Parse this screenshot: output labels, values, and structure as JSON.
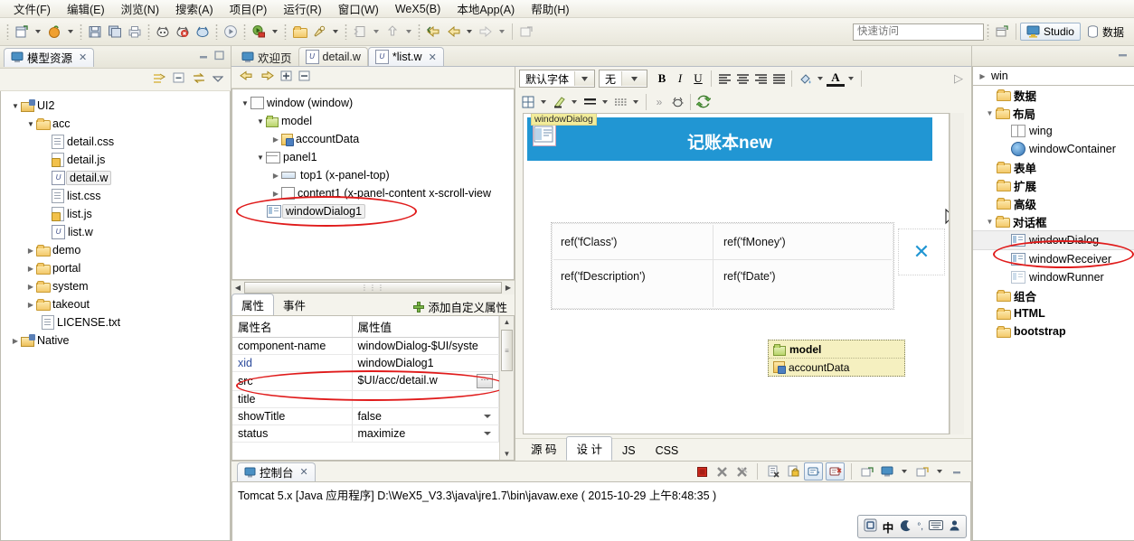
{
  "menubar": [
    {
      "label": "文件(F)",
      "mnemonic": "F"
    },
    {
      "label": "编辑(E)",
      "mnemonic": "E"
    },
    {
      "label": "浏览(N)",
      "mnemonic": "N"
    },
    {
      "label": "搜索(A)",
      "mnemonic": "A"
    },
    {
      "label": "项目(P)",
      "mnemonic": "P"
    },
    {
      "label": "运行(R)",
      "mnemonic": "R"
    },
    {
      "label": "窗口(W)",
      "mnemonic": "W"
    },
    {
      "label": "WeX5(B)",
      "mnemonic": "B"
    },
    {
      "label": "本地App(A)",
      "mnemonic": "A"
    },
    {
      "label": "帮助(H)",
      "mnemonic": "H"
    }
  ],
  "toolbar": {
    "quick_access_placeholder": "快速访问",
    "perspective_studio": "Studio",
    "perspective_data": "数据",
    "icons": [
      "new-file-icon",
      "open-resource-icon",
      "save-icon",
      "save-all-icon",
      "print-icon",
      "build-icon",
      "build-error-icon",
      "build-debug-icon",
      "run-icon",
      "debug-icon",
      "open-type-icon",
      "search-icon",
      "annotation-icon",
      "next-annotation-icon",
      "back-icon",
      "forward-icon",
      "last-edit-icon",
      "new-window-icon"
    ]
  },
  "left_panel": {
    "tab_title": "模型资源",
    "tree": [
      {
        "label": "UI2",
        "depth": 0,
        "icon": "project-icon",
        "state": "open"
      },
      {
        "label": "acc",
        "depth": 1,
        "icon": "folder-icon",
        "state": "open"
      },
      {
        "label": "detail.css",
        "depth": 2,
        "icon": "css-file-icon",
        "state": "leaf"
      },
      {
        "label": "detail.js",
        "depth": 2,
        "icon": "js-file-icon",
        "state": "leaf"
      },
      {
        "label": "detail.w",
        "depth": 2,
        "icon": "w-file-icon",
        "state": "selected"
      },
      {
        "label": "list.css",
        "depth": 2,
        "icon": "css-file-icon",
        "state": "leaf"
      },
      {
        "label": "list.js",
        "depth": 2,
        "icon": "js-file-icon",
        "state": "leaf"
      },
      {
        "label": "list.w",
        "depth": 2,
        "icon": "w-file-icon",
        "state": "leaf"
      },
      {
        "label": "demo",
        "depth": 1,
        "icon": "folder-icon",
        "state": "closed"
      },
      {
        "label": "portal",
        "depth": 1,
        "icon": "folder-icon",
        "state": "closed"
      },
      {
        "label": "system",
        "depth": 1,
        "icon": "folder-icon",
        "state": "closed"
      },
      {
        "label": "takeout",
        "depth": 1,
        "icon": "folder-icon",
        "state": "closed"
      },
      {
        "label": "LICENSE.txt",
        "depth": 2,
        "icon": "text-file-icon",
        "state": "leaf"
      },
      {
        "label": "Native",
        "depth": 0,
        "icon": "project-icon",
        "state": "closed"
      }
    ]
  },
  "editor_tabs": [
    {
      "label": "欢迎页",
      "active": false,
      "dirty": false,
      "icon": "welcome-icon"
    },
    {
      "label": "detail.w",
      "active": false,
      "dirty": false,
      "icon": "w-file-icon"
    },
    {
      "label": "*list.w",
      "active": true,
      "dirty": true,
      "icon": "w-file-icon"
    }
  ],
  "outline": {
    "tree": [
      {
        "label": "window (window)",
        "depth": 0,
        "icon": "window-icon",
        "state": "open"
      },
      {
        "label": "model",
        "depth": 1,
        "icon": "model-icon",
        "state": "open"
      },
      {
        "label": "accountData",
        "depth": 2,
        "icon": "data-icon",
        "state": "closed"
      },
      {
        "label": "panel1",
        "depth": 1,
        "icon": "panel-icon",
        "state": "open"
      },
      {
        "label": "top1 (x-panel-top)",
        "depth": 2,
        "icon": "top-panel-icon",
        "state": "closed"
      },
      {
        "label": "content1 (x-panel-content  x-scroll-view",
        "depth": 2,
        "icon": "content-panel-icon",
        "state": "closed"
      },
      {
        "label": "windowDialog1",
        "depth": 1,
        "icon": "dialog-icon",
        "state": "selected"
      }
    ]
  },
  "properties": {
    "tabs": [
      {
        "label": "属性",
        "active": true
      },
      {
        "label": "事件",
        "active": false
      }
    ],
    "add_custom_label": "添加自定义属性",
    "columns": [
      "属性名",
      "属性值"
    ],
    "rows": [
      {
        "name": "component-name",
        "value": "windowDialog-$UI/syste",
        "control": "none",
        "name_style": "plain"
      },
      {
        "name": "xid",
        "value": "windowDialog1",
        "control": "none",
        "name_style": "link"
      },
      {
        "name": "src",
        "value": "$UI/acc/detail.w",
        "control": "browse",
        "name_style": "plain"
      },
      {
        "name": "title",
        "value": "",
        "control": "none",
        "name_style": "plain"
      },
      {
        "name": "showTitle",
        "value": "false",
        "control": "dropdown",
        "name_style": "plain"
      },
      {
        "name": "status",
        "value": "maximize",
        "control": "dropdown",
        "name_style": "plain"
      }
    ]
  },
  "design": {
    "format_toolbar": {
      "font_family": "默认字体",
      "font_size": "无",
      "bold": "B",
      "italic": "I",
      "underline": "U",
      "align_left": "align-left-icon",
      "align_center": "align-center-icon",
      "align_right": "align-right-icon",
      "align_justify": "align-justify-icon",
      "fill_color": "fill-color-icon",
      "font_color": "font-color-icon"
    },
    "second_toolbar": [
      "table-icon",
      "highlighter-icon",
      "border-weight-icon",
      "border-style-icon",
      "overflow-icon",
      "debug-bug-icon",
      "refresh-icon"
    ],
    "canvas": {
      "dialog_tag": "windowDialog",
      "dialog_title": "记账本new",
      "dialog_title_bg": "#2196d3",
      "close_glyph": "✕",
      "form_cells": [
        "ref('fClass')",
        "ref('fMoney')",
        "ref('fDescription')",
        "ref('fDate')"
      ],
      "model_box": [
        "model",
        "accountData"
      ]
    }
  },
  "editor_bottom_tabs": [
    {
      "label": "源 码",
      "active": false
    },
    {
      "label": "设 计",
      "active": true
    },
    {
      "label": "JS",
      "active": false
    },
    {
      "label": "CSS",
      "active": false
    }
  ],
  "console": {
    "tab_title": "控制台",
    "text": "Tomcat 5.x [Java 应用程序] D:\\WeX5_V3.3\\java\\jre1.7\\bin\\javaw.exe ( 2015-10-29 上午8:48:35 )",
    "toolbar_icons": [
      "terminate-icon",
      "remove-launch-icon",
      "remove-all-launches-icon",
      "clear-console-icon",
      "lock-scroll-icon",
      "show-console-on-output-icon",
      "pin-console-icon",
      "open-console-icon",
      "display-selected-console-icon",
      "new-console-view-icon",
      "minimize-icon"
    ],
    "ime": {
      "mode": "中",
      "glyphs": [
        "ime-logo-icon",
        "中",
        "moon-icon",
        "punctuation-icon",
        "keyboard-icon",
        "user-icon"
      ]
    }
  },
  "right_panel": {
    "root": "win",
    "items": [
      {
        "label": "数据",
        "depth": 1,
        "icon": "folder-icon",
        "state": "closed",
        "bold": true
      },
      {
        "label": "布局",
        "depth": 1,
        "icon": "folder-icon",
        "state": "open",
        "bold": true
      },
      {
        "label": "wing",
        "depth": 2,
        "icon": "wing-icon",
        "state": "leaf",
        "bold": false
      },
      {
        "label": "windowContainer",
        "depth": 2,
        "icon": "container-icon",
        "state": "leaf",
        "bold": false
      },
      {
        "label": "表单",
        "depth": 1,
        "icon": "folder-icon",
        "state": "closed",
        "bold": true
      },
      {
        "label": "扩展",
        "depth": 1,
        "icon": "folder-icon",
        "state": "closed",
        "bold": true
      },
      {
        "label": "高级",
        "depth": 1,
        "icon": "folder-icon",
        "state": "closed",
        "bold": true
      },
      {
        "label": "对话框",
        "depth": 1,
        "icon": "folder-icon",
        "state": "open",
        "bold": true
      },
      {
        "label": "windowDialog",
        "depth": 2,
        "icon": "dialog-icon",
        "state": "selected",
        "bold": false
      },
      {
        "label": "windowReceiver",
        "depth": 2,
        "icon": "dialog-icon",
        "state": "leaf",
        "bold": false
      },
      {
        "label": "windowRunner",
        "depth": 2,
        "icon": "dialog-icon",
        "state": "leaf",
        "bold": false
      },
      {
        "label": "组合",
        "depth": 1,
        "icon": "folder-icon",
        "state": "closed",
        "bold": true
      },
      {
        "label": "HTML",
        "depth": 1,
        "icon": "folder-icon",
        "state": "closed",
        "bold": true
      },
      {
        "label": "bootstrap",
        "depth": 1,
        "icon": "folder-icon",
        "state": "closed",
        "bold": true
      }
    ]
  },
  "annotations": {
    "color": "#e01b1b",
    "ellipses": [
      {
        "name": "outline-windowDialog1-highlight"
      },
      {
        "name": "property-src-highlight"
      },
      {
        "name": "palette-windowDialog-highlight"
      }
    ]
  }
}
